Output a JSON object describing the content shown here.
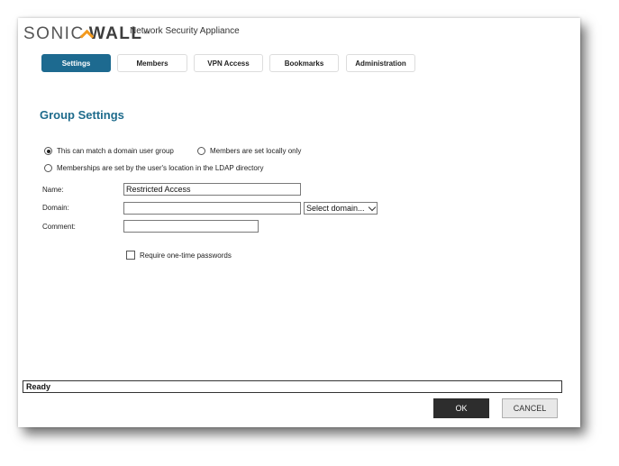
{
  "header": {
    "logo_part1": "SONIC",
    "logo_part2": "WALL",
    "logo_tm": "™",
    "product": "Network Security Appliance"
  },
  "tabs": [
    {
      "label": "Settings",
      "active": true
    },
    {
      "label": "Members",
      "active": false
    },
    {
      "label": "VPN Access",
      "active": false
    },
    {
      "label": "Bookmarks",
      "active": false
    },
    {
      "label": "Administration",
      "active": false
    }
  ],
  "page_title": "Group Settings",
  "membership": {
    "option_domain": "This can match a domain user group",
    "option_local": "Members are set locally only",
    "option_ldap": "Memberships are set by the user's location in the LDAP directory",
    "selected": "option_domain"
  },
  "form": {
    "name_label": "Name:",
    "name_value": "Restricted Access",
    "domain_label": "Domain:",
    "domain_value": "",
    "domain_select": "Select domain...",
    "comment_label": "Comment:",
    "comment_value": "",
    "otp_label": "Require one-time passwords",
    "otp_checked": false
  },
  "status": "Ready",
  "buttons": {
    "ok": "OK",
    "cancel": "CANCEL"
  },
  "colors": {
    "tab_active": "#1d6a90",
    "title": "#1e6b8c",
    "logo_accent": "#f39a1e",
    "ok_button": "#2d2d2d",
    "cancel_button": "#e8e8e8"
  },
  "icons": {
    "logo_mark": "sonicwall-chevron-icon",
    "select_arrow": "chevron-down-icon"
  }
}
